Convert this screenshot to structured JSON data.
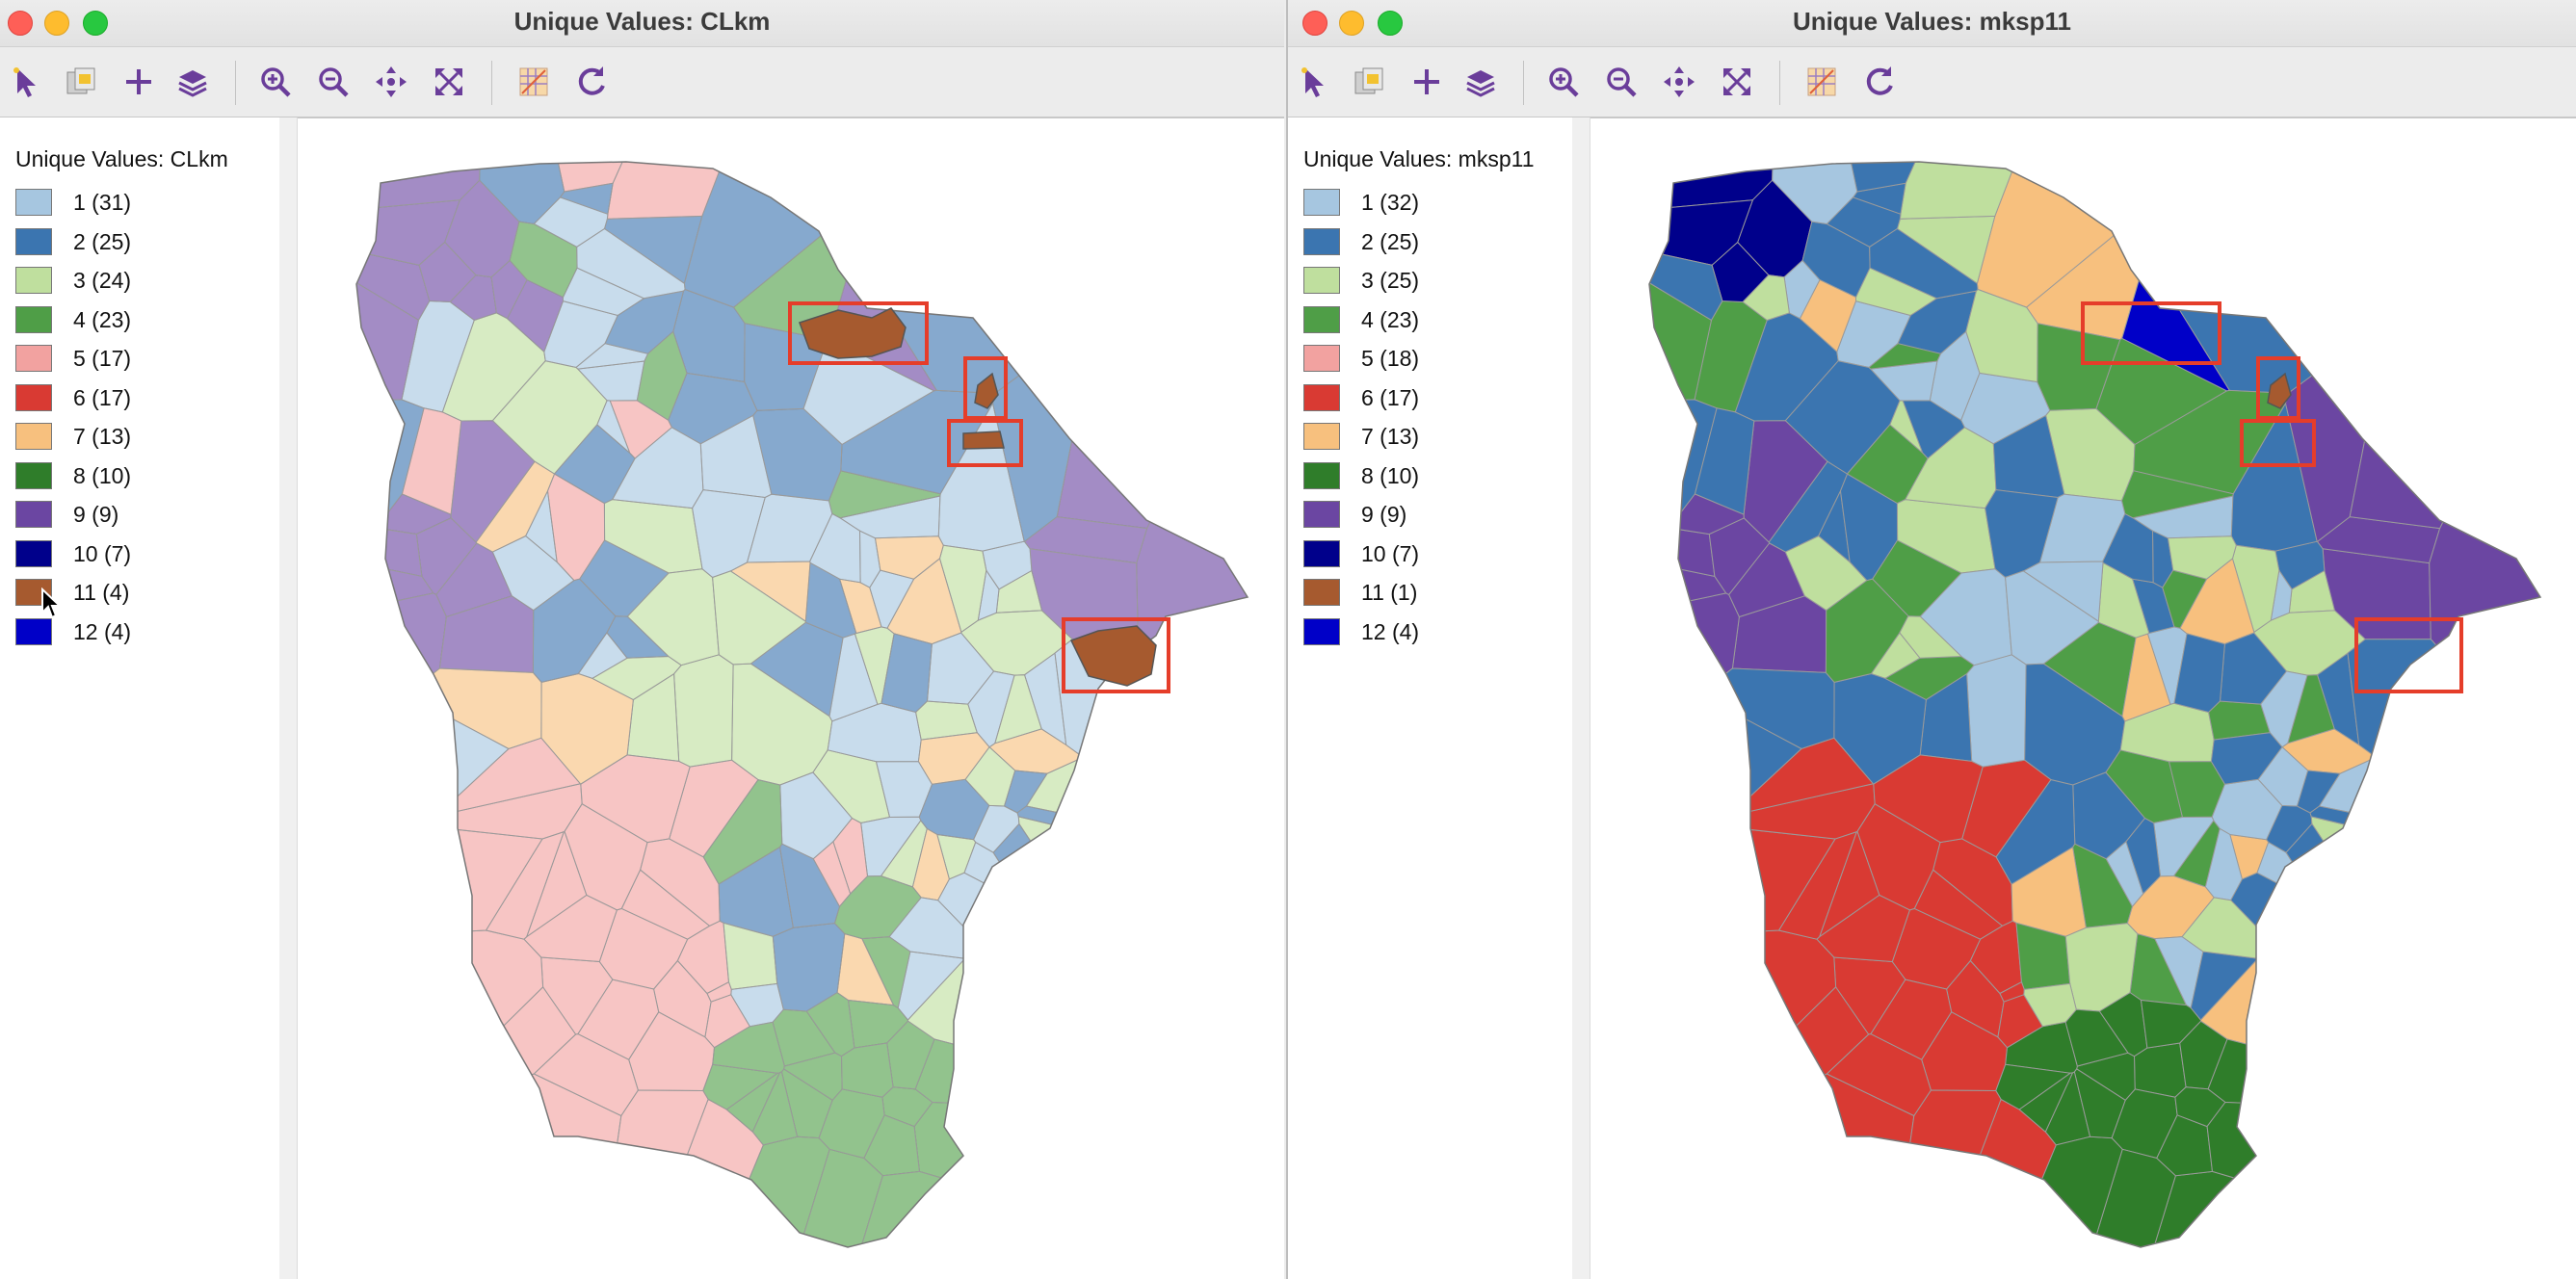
{
  "left": {
    "window_title": "Unique Values: CLkm",
    "legend_title": "Unique Values: CLkm",
    "legend": [
      {
        "label": "1 (31)",
        "color": "#a6c6e0"
      },
      {
        "label": "2 (25)",
        "color": "#3b75b0"
      },
      {
        "label": "3 (24)",
        "color": "#bfdf9e"
      },
      {
        "label": "4 (23)",
        "color": "#4f9e47"
      },
      {
        "label": "5 (17)",
        "color": "#f2a2a0"
      },
      {
        "label": "6 (17)",
        "color": "#d93a33"
      },
      {
        "label": "7 (13)",
        "color": "#f7c07e"
      },
      {
        "label": "8 (10)",
        "color": "#2f7d2a"
      },
      {
        "label": "9 (9)",
        "color": "#6b46a2"
      },
      {
        "label": "10 (7)",
        "color": "#00008b"
      },
      {
        "label": "11 (4)",
        "color": "#a65a2f"
      },
      {
        "label": "12 (4)",
        "color": "#0000c8"
      }
    ]
  },
  "right": {
    "window_title": "Unique Values: mksp11",
    "legend_title": "Unique Values: mksp11",
    "legend": [
      {
        "label": "1 (32)",
        "color": "#a6c6e0"
      },
      {
        "label": "2 (25)",
        "color": "#3b75b0"
      },
      {
        "label": "3 (25)",
        "color": "#bfdf9e"
      },
      {
        "label": "4 (23)",
        "color": "#4f9e47"
      },
      {
        "label": "5 (18)",
        "color": "#f2a2a0"
      },
      {
        "label": "6 (17)",
        "color": "#d93a33"
      },
      {
        "label": "7 (13)",
        "color": "#f7c07e"
      },
      {
        "label": "8 (10)",
        "color": "#2f7d2a"
      },
      {
        "label": "9 (9)",
        "color": "#6b46a2"
      },
      {
        "label": "10 (7)",
        "color": "#00008b"
      },
      {
        "label": "11 (1)",
        "color": "#a65a2f"
      },
      {
        "label": "12 (4)",
        "color": "#0000c8"
      }
    ]
  },
  "toolbar_icons": [
    "select-arrow-icon",
    "copy-image-icon",
    "add-icon",
    "layers-icon",
    "zoom-in-icon",
    "zoom-out-icon",
    "pan-icon",
    "full-extent-icon",
    "selection-shape-icon",
    "refresh-icon"
  ],
  "colors": {
    "highlight_box": "#e53d2a",
    "toolbar_icon": "#6a3d9a",
    "map_outline": "#9a9a9a"
  }
}
